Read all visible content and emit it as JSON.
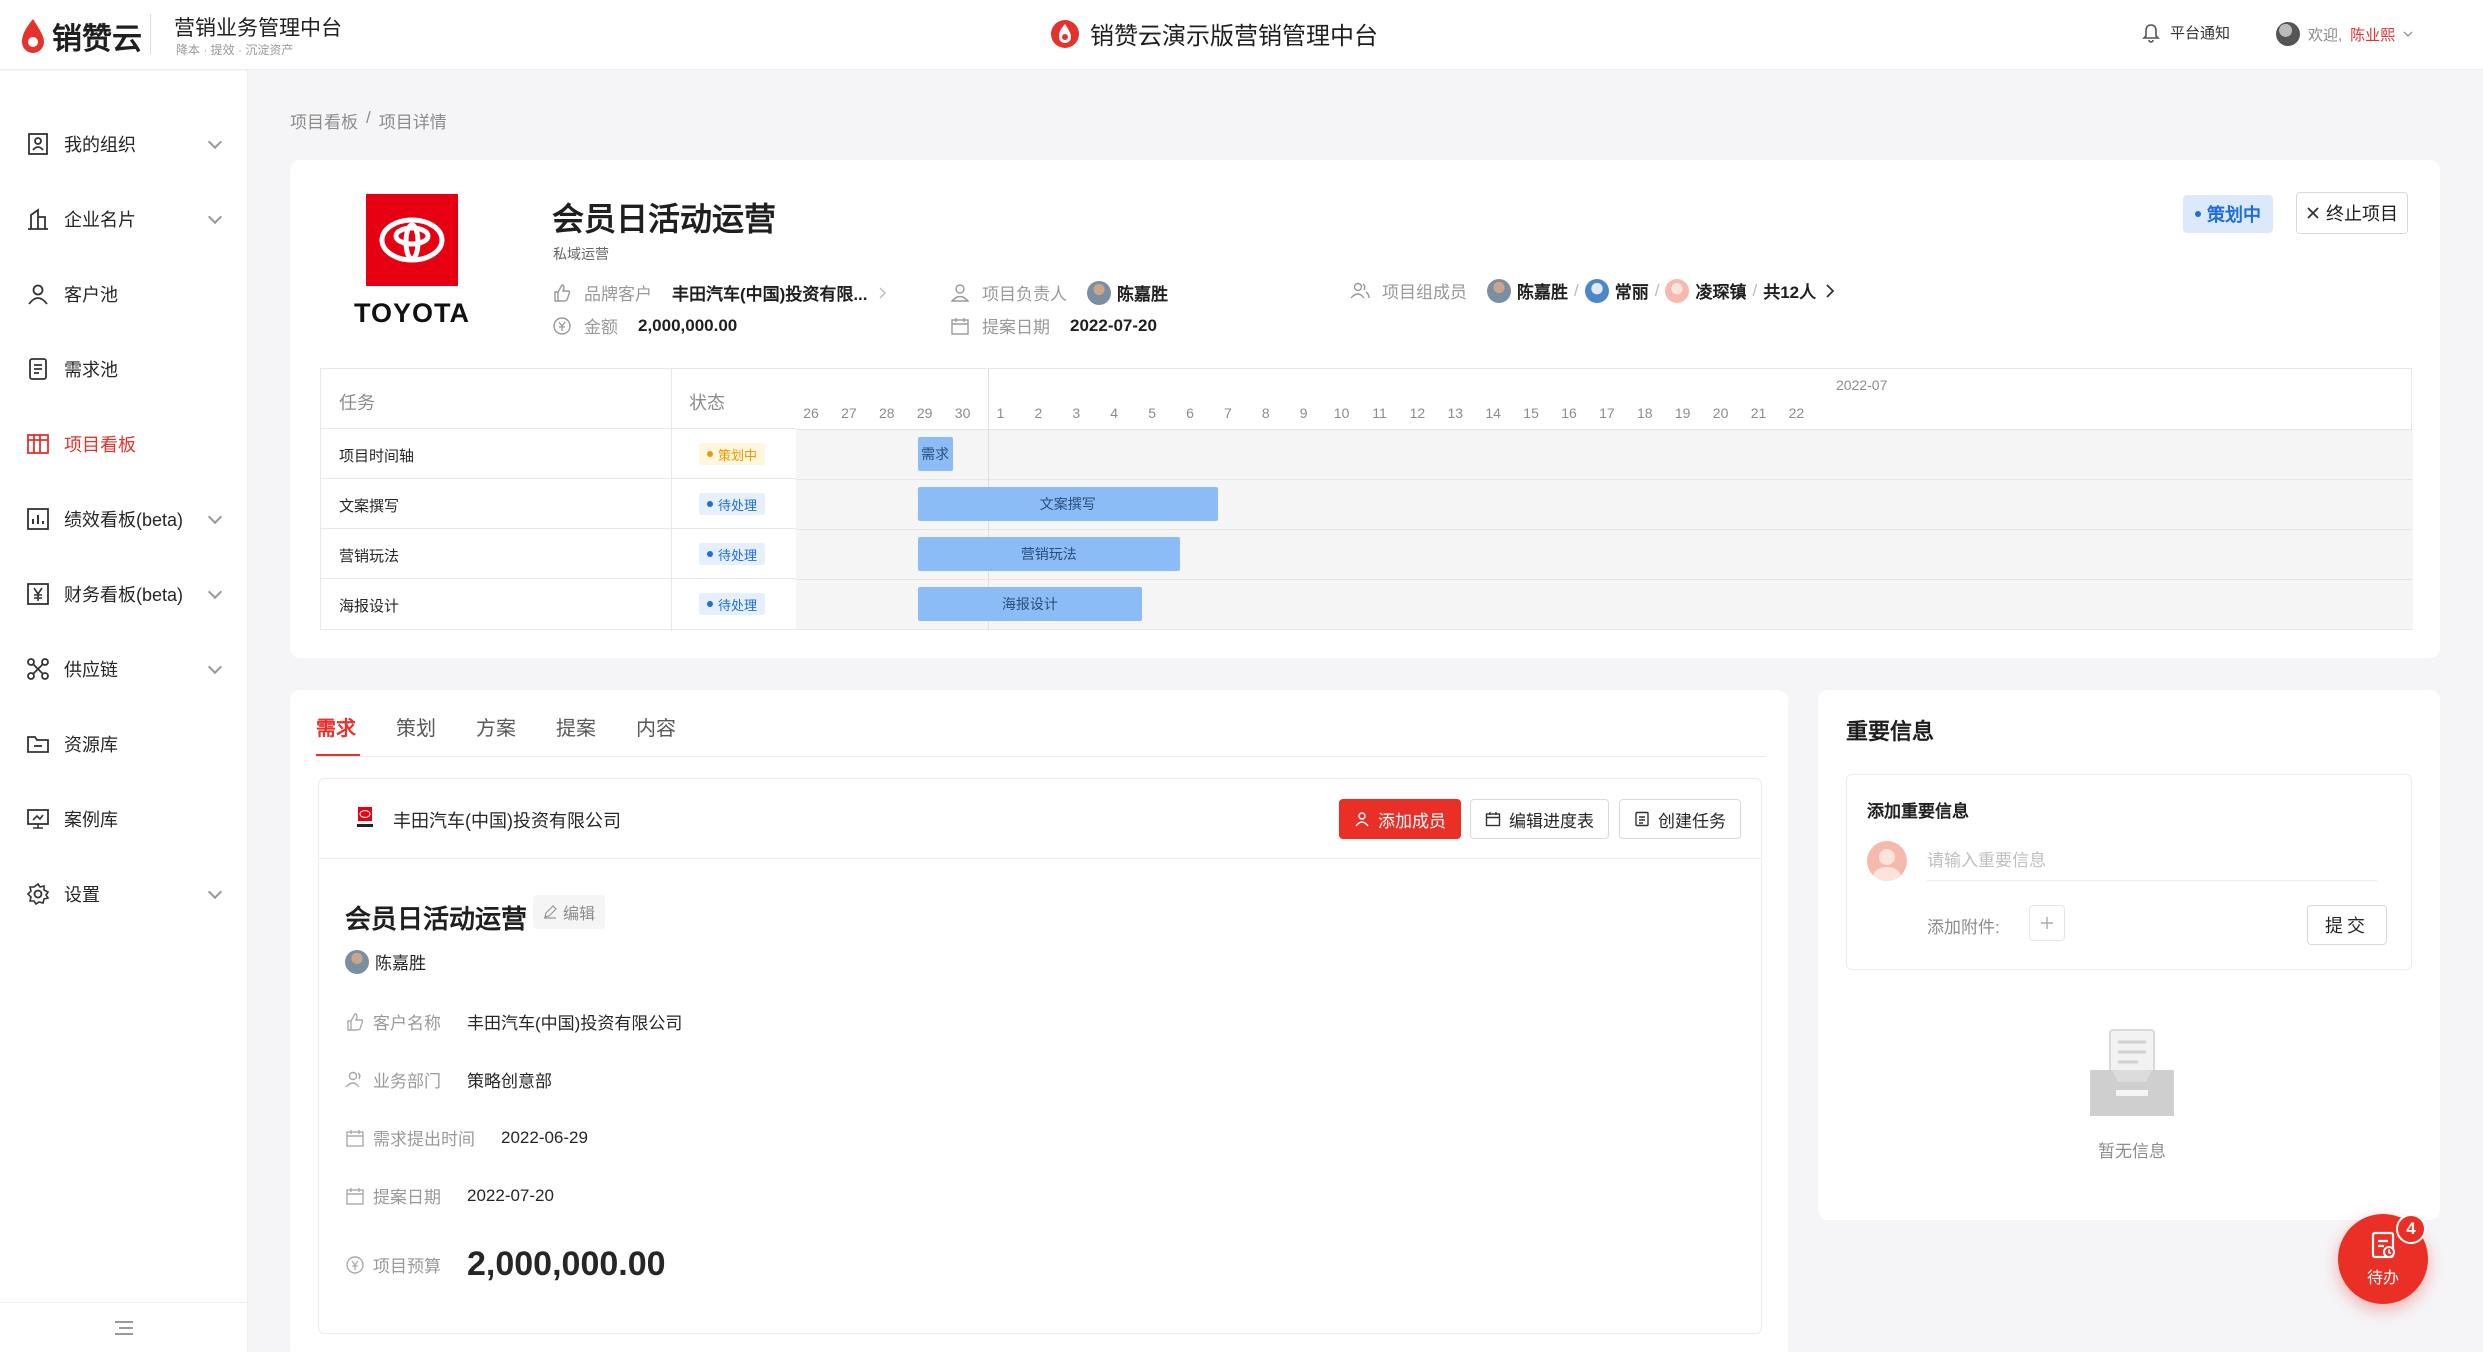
{
  "header": {
    "logo_text": "销赞云",
    "system_name": "营销业务管理中台",
    "system_sub": "降本 · 提效 · 沉淀资产",
    "center_title": "销赞云演示版营销管理中台",
    "notify_label": "平台通知",
    "welcome": "欢迎,",
    "user_name": "陈业熙"
  },
  "sidebar": {
    "items": [
      {
        "label": "我的组织",
        "icon": "org-icon"
      },
      {
        "label": "企业名片",
        "icon": "enterprise-icon"
      },
      {
        "label": "客户池",
        "icon": "user-icon"
      },
      {
        "label": "需求池",
        "icon": "document-icon"
      },
      {
        "label": "项目看板",
        "icon": "kanban-icon"
      },
      {
        "label": "绩效看板(beta)",
        "icon": "chart-icon"
      },
      {
        "label": "财务看板(beta)",
        "icon": "yen-icon"
      },
      {
        "label": "供应链",
        "icon": "network-icon"
      },
      {
        "label": "资源库",
        "icon": "folder-icon"
      },
      {
        "label": "案例库",
        "icon": "presentation-icon"
      },
      {
        "label": "设置",
        "icon": "gear-icon"
      }
    ]
  },
  "breadcrumb": {
    "root": "项目看板",
    "sep": "/",
    "current": "项目详情"
  },
  "project": {
    "logo_word": "TOYOTA",
    "title": "会员日活动运营",
    "subtitle": "私域运营",
    "brand_label": "品牌客户",
    "brand_value": "丰田汽车(中国)投资有限...",
    "amount_label": "金额",
    "amount_value": "2,000,000.00",
    "owner_label": "项目负责人",
    "owner_value": "陈嘉胜",
    "date_label": "提案日期",
    "date_value": "2022-07-20",
    "members_label": "项目组成员",
    "members": [
      "陈嘉胜",
      "常丽",
      "凌琛镇"
    ],
    "member_sep": "/",
    "members_total": "共12人",
    "status": "策划中",
    "end_button": "终止项目"
  },
  "gantt": {
    "col_task": "任务",
    "col_status": "状态",
    "month": "2022-07",
    "days": [
      "26",
      "27",
      "28",
      "29",
      "30",
      "1",
      "2",
      "3",
      "4",
      "5",
      "6",
      "7",
      "8",
      "9",
      "10",
      "11",
      "12",
      "13",
      "14",
      "15",
      "16",
      "17",
      "18",
      "19",
      "20",
      "21",
      "22"
    ],
    "rows": [
      {
        "name": "项目时间轴",
        "status": "策划中",
        "status_type": "plan",
        "bar": "需求",
        "start_index": 3,
        "span": 0.92
      },
      {
        "name": "文案撰写",
        "status": "待处理",
        "status_type": "todo",
        "bar": "文案撰写",
        "start_index": 3,
        "span": 7.92
      },
      {
        "name": "营销玩法",
        "status": "待处理",
        "status_type": "todo",
        "bar": "营销玩法",
        "start_index": 3,
        "span": 6.92
      },
      {
        "name": "海报设计",
        "status": "待处理",
        "status_type": "todo",
        "bar": "海报设计",
        "start_index": 3,
        "span": 5.92
      }
    ]
  },
  "tabs": [
    "需求",
    "策划",
    "方案",
    "提案",
    "内容"
  ],
  "detail": {
    "company": "丰田汽车(中国)投资有限公司",
    "btn_add_member": "添加成员",
    "btn_edit_schedule": "编辑进度表",
    "btn_create_task": "创建任务",
    "title": "会员日活动运营",
    "edit_label": "编辑",
    "owner": "陈嘉胜",
    "fields": [
      {
        "label": "客户名称",
        "value": "丰田汽车(中国)投资有限公司"
      },
      {
        "label": "业务部门",
        "value": "策略创意部"
      },
      {
        "label": "需求提出时间",
        "value": "2022-06-29"
      },
      {
        "label": "提案日期",
        "value": "2022-07-20"
      },
      {
        "label": "项目预算",
        "value": "2,000,000.00"
      }
    ]
  },
  "info": {
    "title": "重要信息",
    "box_title": "添加重要信息",
    "placeholder": "请输入重要信息",
    "attach_label": "添加附件:",
    "submit": "提交",
    "empty_text": "暂无信息"
  },
  "todo": {
    "label": "待办",
    "count": "4"
  },
  "colors": {
    "accent": "#e5322d",
    "blue": "#1d6ddc",
    "bar": "#8cbcf6"
  }
}
